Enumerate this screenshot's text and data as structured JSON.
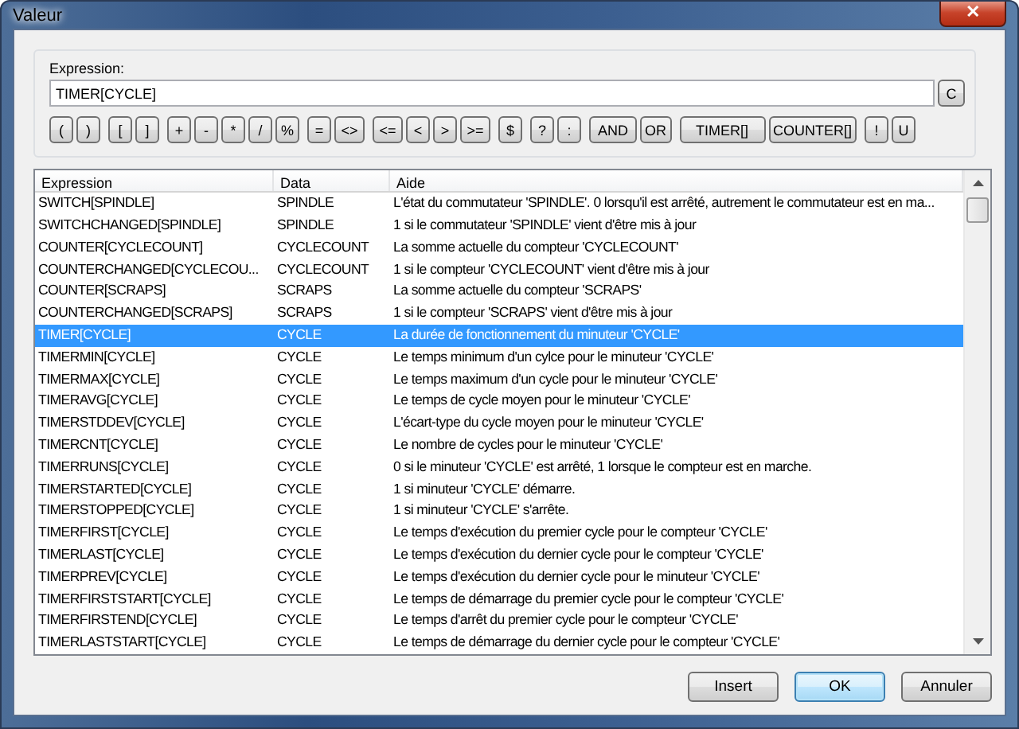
{
  "window": {
    "title": "Valeur",
    "close": "✕"
  },
  "expression": {
    "label": "Expression:",
    "value": "TIMER[CYCLE]",
    "clear_button": "C"
  },
  "operator_groups": [
    [
      "(",
      ")"
    ],
    [
      "[",
      "]"
    ],
    [
      "+",
      "-",
      "*",
      "/",
      "%"
    ],
    [
      "=",
      "<>"
    ],
    [
      "<=",
      "<",
      ">",
      ">="
    ],
    [
      "$"
    ],
    [
      "?",
      ":"
    ],
    [
      "AND",
      "OR"
    ],
    [
      "TIMER[]",
      "COUNTER[]"
    ],
    [
      "!",
      "U"
    ]
  ],
  "table": {
    "columns": [
      "Expression",
      "Data",
      "Aide"
    ],
    "rows": [
      {
        "expression": "SWITCH[SPINDLE]",
        "data": "SPINDLE",
        "aide": "L'état du commutateur 'SPINDLE'. 0 lorsqu'il est arrêté, autrement le commutateur est en ma...",
        "selected": false
      },
      {
        "expression": "SWITCHCHANGED[SPINDLE]",
        "data": "SPINDLE",
        "aide": "1 si le commutateur 'SPINDLE' vient d'être mis à jour",
        "selected": false
      },
      {
        "expression": "COUNTER[CYCLECOUNT]",
        "data": "CYCLECOUNT",
        "aide": "La somme actuelle du compteur 'CYCLECOUNT'",
        "selected": false
      },
      {
        "expression": "COUNTERCHANGED[CYCLECOU...",
        "data": "CYCLECOUNT",
        "aide": "1 si le compteur 'CYCLECOUNT' vient d'être mis à jour",
        "selected": false
      },
      {
        "expression": "COUNTER[SCRAPS]",
        "data": "SCRAPS",
        "aide": "La somme actuelle du compteur 'SCRAPS'",
        "selected": false
      },
      {
        "expression": "COUNTERCHANGED[SCRAPS]",
        "data": "SCRAPS",
        "aide": "1 si le compteur 'SCRAPS' vient d'être mis à jour",
        "selected": false
      },
      {
        "expression": "TIMER[CYCLE]",
        "data": "CYCLE",
        "aide": "La durée de fonctionnement du minuteur 'CYCLE'",
        "selected": true
      },
      {
        "expression": "TIMERMIN[CYCLE]",
        "data": "CYCLE",
        "aide": "Le temps minimum d'un cylce pour le minuteur 'CYCLE'",
        "selected": false
      },
      {
        "expression": "TIMERMAX[CYCLE]",
        "data": "CYCLE",
        "aide": "Le temps maximum d'un cycle pour le minuteur 'CYCLE'",
        "selected": false
      },
      {
        "expression": "TIMERAVG[CYCLE]",
        "data": "CYCLE",
        "aide": "Le temps de cycle moyen pour le minuteur 'CYCLE'",
        "selected": false
      },
      {
        "expression": "TIMERSTDDEV[CYCLE]",
        "data": "CYCLE",
        "aide": "L'écart-type du cycle moyen pour le minuteur 'CYCLE'",
        "selected": false
      },
      {
        "expression": "TIMERCNT[CYCLE]",
        "data": "CYCLE",
        "aide": "Le nombre de cycles pour le minuteur 'CYCLE'",
        "selected": false
      },
      {
        "expression": "TIMERRUNS[CYCLE]",
        "data": "CYCLE",
        "aide": "0 si le minuteur 'CYCLE' est arrêté, 1 lorsque le compteur est en marche.",
        "selected": false
      },
      {
        "expression": "TIMERSTARTED[CYCLE]",
        "data": "CYCLE",
        "aide": "1 si minuteur 'CYCLE' démarre.",
        "selected": false
      },
      {
        "expression": "TIMERSTOPPED[CYCLE]",
        "data": "CYCLE",
        "aide": "1 si minuteur 'CYCLE' s'arrête.",
        "selected": false
      },
      {
        "expression": "TIMERFIRST[CYCLE]",
        "data": "CYCLE",
        "aide": "Le temps d'exécution du premier cycle pour le compteur 'CYCLE'",
        "selected": false
      },
      {
        "expression": "TIMERLAST[CYCLE]",
        "data": "CYCLE",
        "aide": "Le temps d'exécution du dernier cycle pour le compteur 'CYCLE'",
        "selected": false
      },
      {
        "expression": "TIMERPREV[CYCLE]",
        "data": "CYCLE",
        "aide": "Le temps d'exécution du dernier cycle pour le minuteur 'CYCLE'",
        "selected": false
      },
      {
        "expression": "TIMERFIRSTSTART[CYCLE]",
        "data": "CYCLE",
        "aide": "Le temps de démarrage du premier cycle pour le compteur 'CYCLE'",
        "selected": false
      },
      {
        "expression": "TIMERFIRSTEND[CYCLE]",
        "data": "CYCLE",
        "aide": "Le temps d'arrêt du premier cycle pour le compteur 'CYCLE'",
        "selected": false
      },
      {
        "expression": "TIMERLASTSTART[CYCLE]",
        "data": "CYCLE",
        "aide": "Le temps de démarrage du dernier cycle pour le compteur 'CYCLE'",
        "selected": false
      }
    ]
  },
  "buttons": [
    {
      "label": "Insert",
      "default": false
    },
    {
      "label": "OK",
      "default": true
    },
    {
      "label": "Annuler",
      "default": false
    }
  ]
}
